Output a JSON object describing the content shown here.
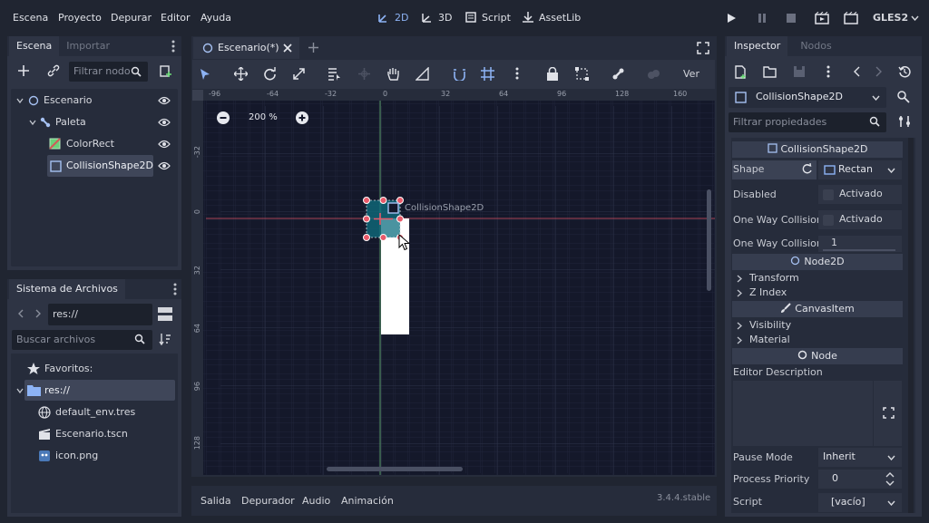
{
  "menu": [
    "Escena",
    "Proyecto",
    "Depurar",
    "Editor",
    "Ayuda"
  ],
  "modes": {
    "2d": "2D",
    "3d": "3D",
    "script": "Script",
    "assetlib": "AssetLib"
  },
  "renderer": "GLES2",
  "scene_panel": {
    "tabs": [
      "Escena",
      "Importar"
    ],
    "filter_placeholder": "Filtrar nodo",
    "nodes": [
      {
        "label": "Escenario",
        "icon": "node2d-icon"
      },
      {
        "label": "Paleta",
        "icon": "bone-icon"
      },
      {
        "label": "ColorRect",
        "icon": "colorrect-icon"
      },
      {
        "label": "CollisionShape2D",
        "icon": "collisionshape-icon"
      }
    ]
  },
  "filesystem": {
    "tab": "Sistema de Archivos",
    "path": "res://",
    "search_placeholder": "Buscar archivos",
    "items": [
      {
        "label": "Favoritos:",
        "icon": "star-icon"
      },
      {
        "label": "res://",
        "icon": "folder-icon"
      },
      {
        "label": "default_env.tres",
        "icon": "globe-icon"
      },
      {
        "label": "Escenario.tscn",
        "icon": "clapper-icon"
      },
      {
        "label": "icon.png",
        "icon": "image-icon"
      }
    ]
  },
  "editor": {
    "tab_title": "Escenario(*)",
    "view_label": "Ver",
    "zoom": "200 %",
    "shape_label": "CollisionShape2D",
    "ruler_x": [
      "-96",
      "-64",
      "-32",
      "0",
      "32",
      "64",
      "96",
      "128",
      "160"
    ],
    "ruler_y": [
      "-32",
      "0",
      "32",
      "64",
      "96",
      "128"
    ]
  },
  "bottom": {
    "tabs": [
      "Salida",
      "Depurador",
      "Audio",
      "Animación"
    ],
    "version": "3.4.4.stable"
  },
  "inspector": {
    "tabs": [
      "Inspector",
      "Nodos"
    ],
    "node": "CollisionShape2D",
    "filter_placeholder": "Filtrar propiedades",
    "header": "CollisionShape2D",
    "shape_label": "Shape",
    "shape_value": "Rectan",
    "disabled_label": "Disabled",
    "disabled_value": "Activado",
    "oneway_label": "One Way Collision",
    "oneway_value": "Activado",
    "oneway_margin_label": "One Way Collision",
    "oneway_margin_value": "1",
    "node2d_header": "Node2D",
    "transform": "Transform",
    "zindex": "Z Index",
    "canvasitem_header": "CanvasItem",
    "visibility": "Visibility",
    "material": "Material",
    "node_header": "Node",
    "editor_desc": "Editor Description",
    "pause_label": "Pause Mode",
    "pause_value": "Inherit",
    "priority_label": "Process Priority",
    "priority_value": "0",
    "script_label": "Script",
    "script_value": "[vacío]"
  }
}
